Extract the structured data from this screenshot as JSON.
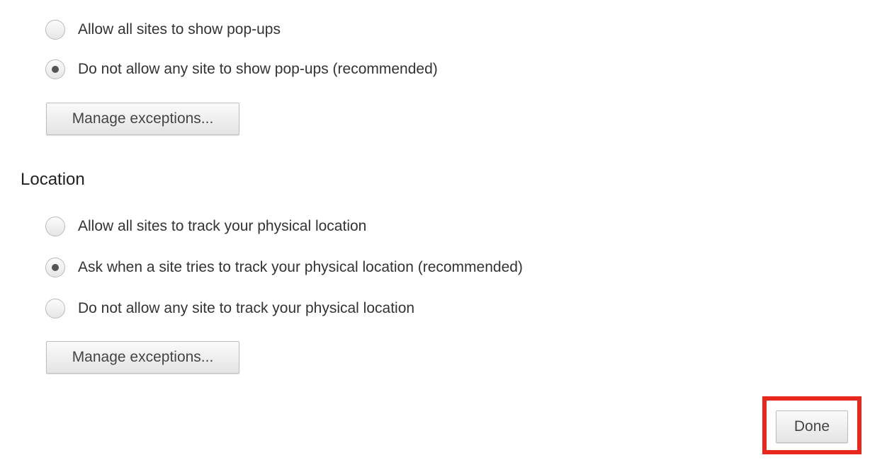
{
  "popups": {
    "options": [
      {
        "label": "Allow all sites to show pop-ups",
        "selected": false
      },
      {
        "label": "Do not allow any site to show pop-ups (recommended)",
        "selected": true
      }
    ],
    "manage_label": "Manage exceptions..."
  },
  "location": {
    "title": "Location",
    "options": [
      {
        "label": "Allow all sites to track your physical location",
        "selected": false
      },
      {
        "label": "Ask when a site tries to track your physical location (recommended)",
        "selected": true
      },
      {
        "label": "Do not allow any site to track your physical location",
        "selected": false
      }
    ],
    "manage_label": "Manage exceptions..."
  },
  "done_label": "Done",
  "highlight_color": "#e8281c"
}
